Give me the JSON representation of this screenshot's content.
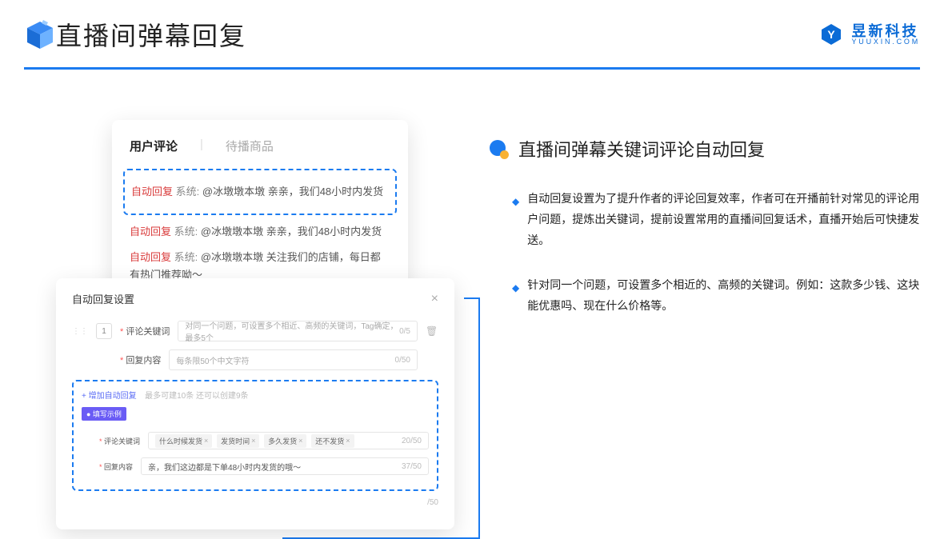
{
  "header": {
    "title": "直播间弹幕回复",
    "brand_cn": "昱新科技",
    "brand_en": "YUUXIN.COM"
  },
  "cardA": {
    "tabs": {
      "active": "用户评论",
      "inactive": "待播商品"
    },
    "msg1": {
      "tag": "自动回复",
      "sys": "系统:",
      "body": "@冰墩墩本墩 亲亲，我们48小时内发货"
    },
    "msg2": {
      "tag": "自动回复",
      "sys": "系统:",
      "body": "@冰墩墩本墩 亲亲，我们48小时内发货"
    },
    "msg3": {
      "tag": "自动回复",
      "sys": "系统:",
      "body": "@冰墩墩本墩 关注我们的店铺，每日都有热门推荐呦～"
    }
  },
  "cardB": {
    "title": "自动回复设置",
    "seq": "1",
    "row1": {
      "label": "评论关键词",
      "placeholder": "对同一个问题，可设置多个相近、高频的关键词，Tag确定，最多5个",
      "count": "0/5"
    },
    "row2": {
      "label": "回复内容",
      "placeholder": "每条限50个中文字符",
      "count": "0/50"
    },
    "add_link": "+ 增加自动回复",
    "add_note": "最多可建10条 还可以创建9条",
    "badge": "● 填写示例",
    "ex1": {
      "label": "评论关键词",
      "tags": [
        "什么时候发货",
        "发货时间",
        "多久发货",
        "还不发货"
      ],
      "count": "20/50"
    },
    "ex2": {
      "label": "回复内容",
      "text": "亲，我们这边都是下单48小时内发货的哦～",
      "count": "37/50"
    },
    "outer_count": "/50"
  },
  "right": {
    "section_title": "直播间弹幕关键词评论自动回复",
    "b1": "自动回复设置为了提升作者的评论回复效率，作者可在开播前针对常见的评论用户问题，提炼出关键词，提前设置常用的直播间回复话术，直播开始后可快捷发送。",
    "b2": "针对同一个问题，可设置多个相近的、高频的关键词。例如：这款多少钱、这块能优惠吗、现在什么价格等。"
  }
}
